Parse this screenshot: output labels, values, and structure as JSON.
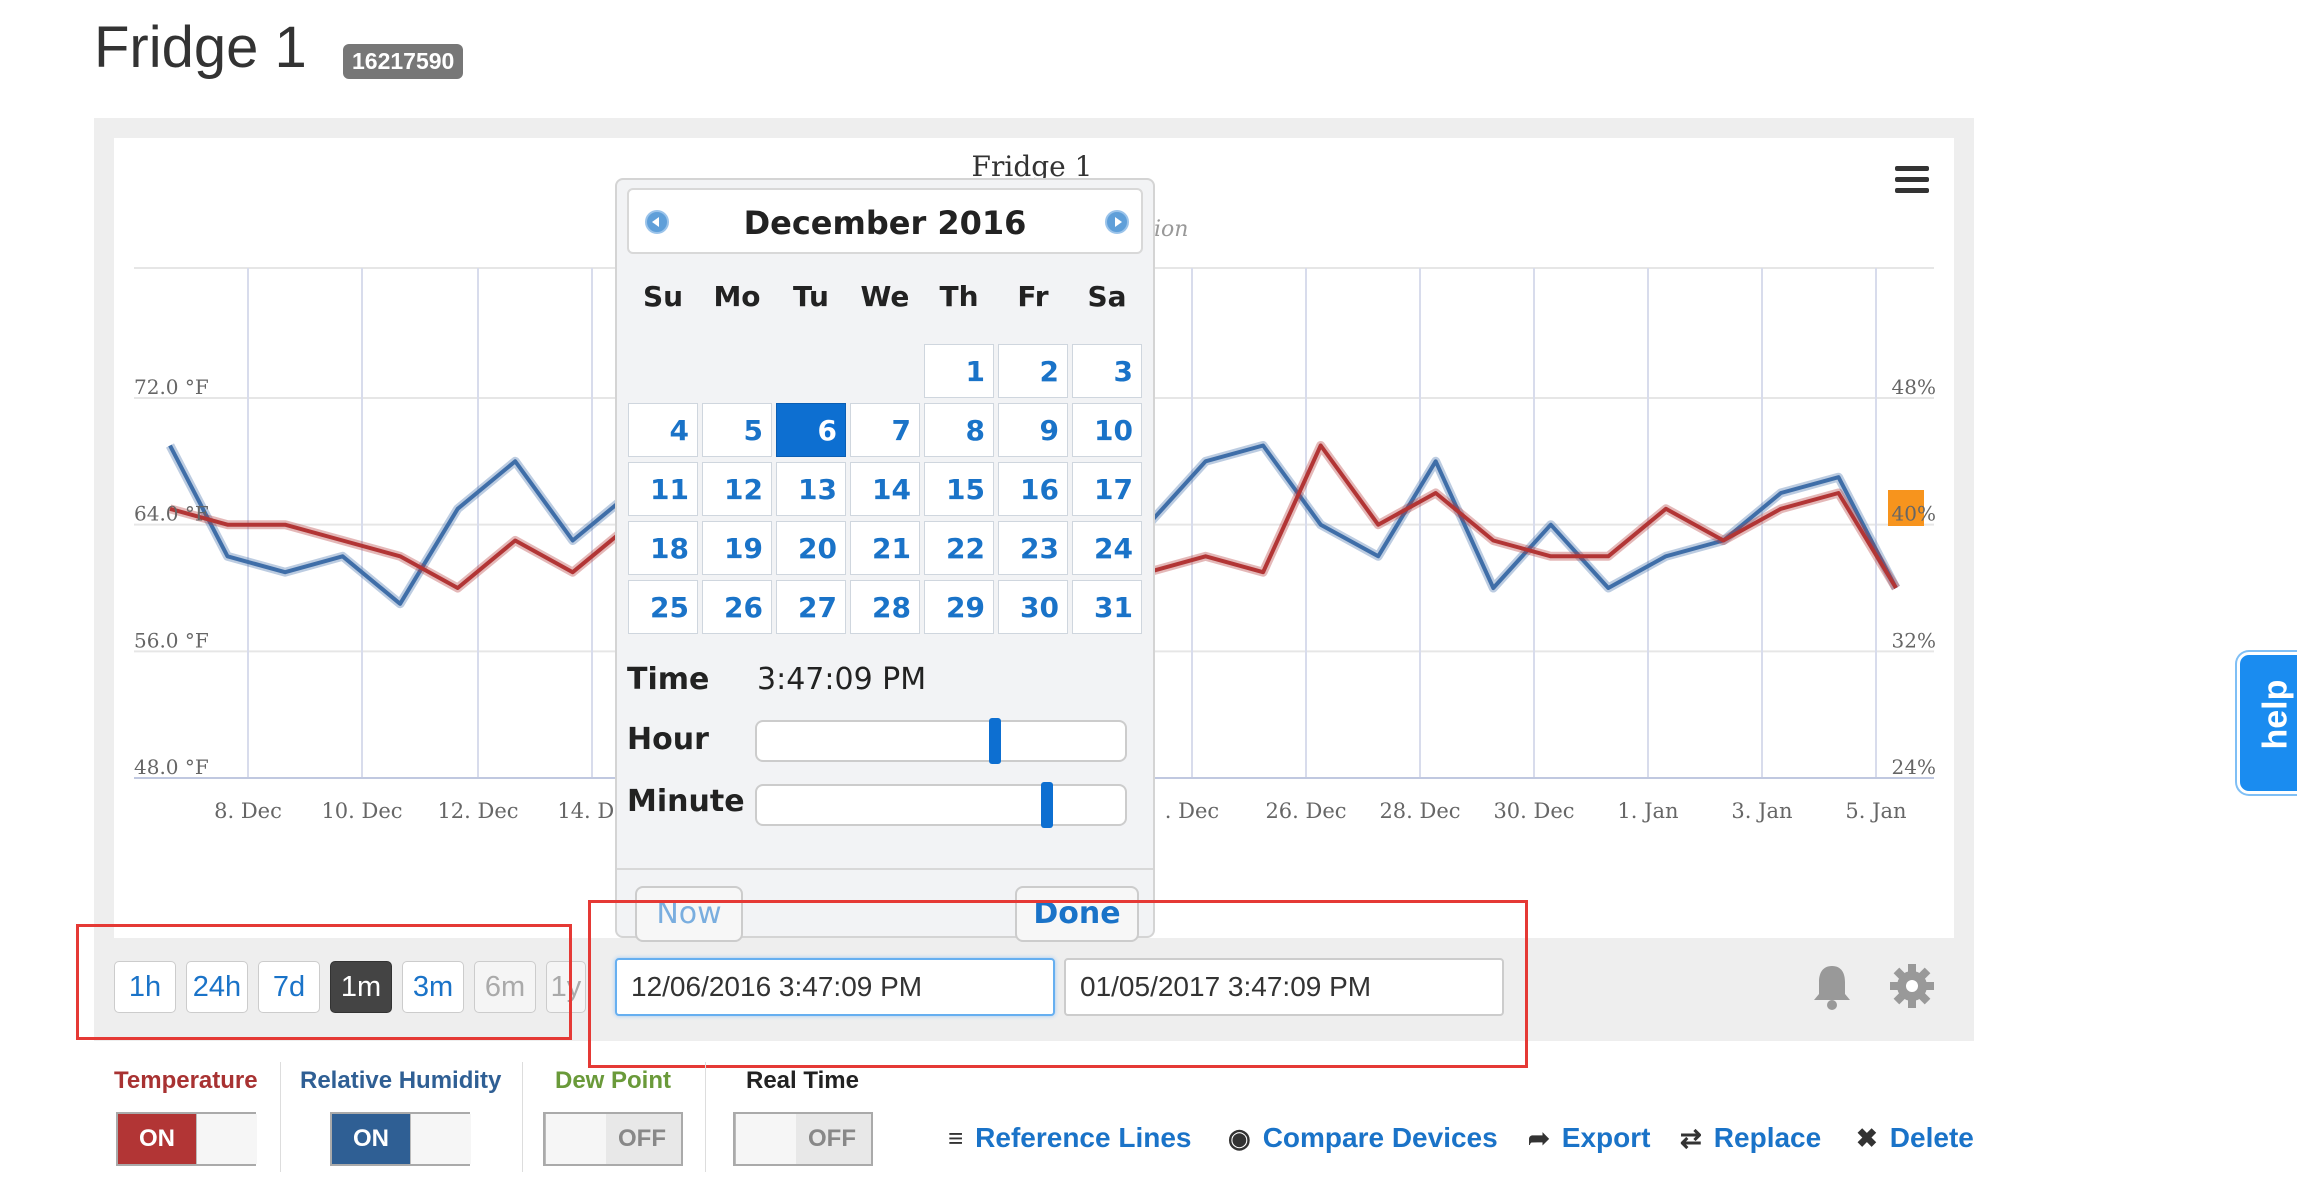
{
  "page": {
    "title": "Fridge 1",
    "device_id": "16217590"
  },
  "chart": {
    "title": "Fridge 1",
    "subtitle_fragment": "ion",
    "left_axis_ticks": [
      "72.0 °F",
      "64.0 °F",
      "56.0 °F",
      "48.0 °F"
    ],
    "right_axis_ticks": [
      "48%",
      "40%",
      "32%",
      "24%"
    ],
    "x_ticks": [
      "8. Dec",
      "10. Dec",
      "12. Dec",
      "14. De",
      ". Dec",
      "26. Dec",
      "28. Dec",
      "30. Dec",
      "1. Jan",
      "3. Jan",
      "5. Jan"
    ],
    "colors": {
      "temperature": "#3f6ea8",
      "humidity": "#b23535",
      "marker": "#f7941d"
    }
  },
  "chart_data": {
    "type": "line",
    "x_axis": "Date",
    "left_axis": {
      "unit": "°F",
      "ylim": [
        48,
        72
      ]
    },
    "right_axis": {
      "unit": "%",
      "ylim": [
        24,
        48
      ]
    },
    "series": [
      {
        "color": "#3f6ea8",
        "axis": "left",
        "x": [
          "2016-12-06",
          "2016-12-07",
          "2016-12-08",
          "2016-12-09",
          "2016-12-10",
          "2016-12-11",
          "2016-12-12",
          "2016-12-13",
          "2016-12-14",
          "2016-12-15",
          "2016-12-23",
          "2016-12-24",
          "2016-12-25",
          "2016-12-26",
          "2016-12-27",
          "2016-12-28",
          "2016-12-29",
          "2016-12-30",
          "2016-12-31",
          "2017-01-01",
          "2017-01-02",
          "2017-01-03",
          "2017-01-04",
          "2017-01-05"
        ],
        "values": [
          69,
          62,
          61,
          62,
          59,
          65,
          68,
          63,
          66,
          64,
          64,
          68,
          69,
          64,
          62,
          68,
          60,
          64,
          60,
          62,
          63,
          66,
          67,
          60
        ]
      },
      {
        "color": "#b23535",
        "axis": "right",
        "x": [
          "2016-12-06",
          "2016-12-07",
          "2016-12-08",
          "2016-12-09",
          "2016-12-10",
          "2016-12-11",
          "2016-12-12",
          "2016-12-13",
          "2016-12-14",
          "2016-12-15",
          "2016-12-23",
          "2016-12-24",
          "2016-12-25",
          "2016-12-26",
          "2016-12-27",
          "2016-12-28",
          "2016-12-29",
          "2016-12-30",
          "2016-12-31",
          "2017-01-01",
          "2017-01-02",
          "2017-01-03",
          "2017-01-04",
          "2017-01-05"
        ],
        "values": [
          41,
          40,
          40,
          39,
          38,
          36,
          39,
          37,
          40,
          35,
          37,
          38,
          37,
          45,
          40,
          42,
          39,
          38,
          38,
          41,
          39,
          41,
          42,
          36
        ]
      }
    ]
  },
  "timeframes": [
    "1h",
    "24h",
    "7d",
    "1m",
    "3m",
    "6m",
    "1y"
  ],
  "active_timeframe": "1m",
  "range": {
    "start": "12/06/2016 3:47:09 PM",
    "end": "01/05/2017 3:47:09 PM"
  },
  "datepicker": {
    "month_year": "December  2016",
    "weekdays": [
      "Su",
      "Mo",
      "Tu",
      "We",
      "Th",
      "Fr",
      "Sa"
    ],
    "weeks": [
      [
        "",
        "",
        "",
        "",
        "1",
        "2",
        "3"
      ],
      [
        "4",
        "5",
        "6",
        "7",
        "8",
        "9",
        "10"
      ],
      [
        "11",
        "12",
        "13",
        "14",
        "15",
        "16",
        "17"
      ],
      [
        "18",
        "19",
        "20",
        "21",
        "22",
        "23",
        "24"
      ],
      [
        "25",
        "26",
        "27",
        "28",
        "29",
        "30",
        "31"
      ]
    ],
    "selected_day": "6",
    "time_label": "Time",
    "time_value": "3:47:09 PM",
    "hour_label": "Hour",
    "hour_value": 15,
    "minute_label": "Minute",
    "minute_value": 47,
    "now_label": "Now",
    "done_label": "Done"
  },
  "help_label": "help",
  "toggles": [
    {
      "label": "Temperature",
      "label_color": "#a83232",
      "state": "ON",
      "on_color": "#b23535"
    },
    {
      "label": "Relative Humidity",
      "label_color": "#2f5f94",
      "state": "ON",
      "on_color": "#2f5f94"
    },
    {
      "label": "Dew Point",
      "label_color": "#6a9a3a",
      "state": "OFF"
    },
    {
      "label": "Real Time",
      "label_color": "#222222",
      "state": "OFF"
    }
  ],
  "actions": [
    {
      "label": "Reference Lines",
      "icon": "list-icon"
    },
    {
      "label": "Compare Devices",
      "icon": "eye-icon"
    },
    {
      "label": "Export",
      "icon": "share-arrow-icon"
    },
    {
      "label": "Replace",
      "icon": "shuffle-icon"
    },
    {
      "label": "Delete",
      "icon": "x-icon"
    }
  ]
}
